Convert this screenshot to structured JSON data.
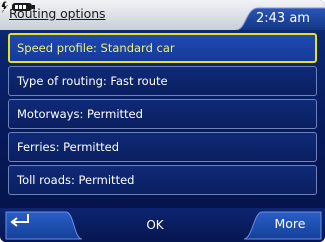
{
  "header": {
    "title": "Routing options",
    "time": "2:43 am"
  },
  "options": [
    {
      "label": "Speed profile: Standard car",
      "selected": true
    },
    {
      "label": "Type of routing: Fast route",
      "selected": false
    },
    {
      "label": "Motorways: Permitted",
      "selected": false
    },
    {
      "label": "Ferries: Permitted",
      "selected": false
    },
    {
      "label": "Toll roads: Permitted",
      "selected": false
    }
  ],
  "footer": {
    "ok_label": "OK",
    "more_label": "More"
  },
  "icons": {
    "power": "power-plug-battery-icon",
    "clock": "clock-icon",
    "back": "back-arrow-icon"
  },
  "colors": {
    "background": "#0a1f60",
    "selected_border": "#e6e020",
    "selected_text": "#f2f076",
    "header_bar": "#d8dce4"
  }
}
